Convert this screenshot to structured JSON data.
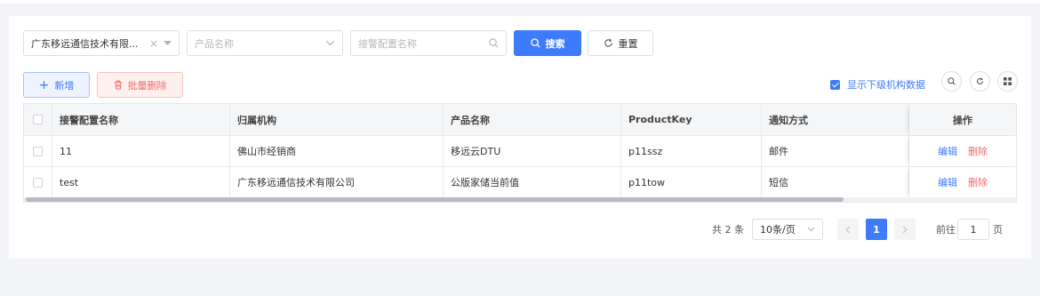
{
  "filters": {
    "org_value": "广东移远通信技术有限...",
    "product_placeholder": "产品名称",
    "alarm_placeholder": "接警配置名称"
  },
  "buttons": {
    "search": "搜索",
    "reset": "重置",
    "add": "新增",
    "batch_delete": "批量删除"
  },
  "toolbar": {
    "show_sub_org": "显示下级机构数据",
    "show_sub_org_checked": true
  },
  "table": {
    "headers": [
      "接警配置名称",
      "归属机构",
      "产品名称",
      "ProductKey",
      "通知方式",
      "操作"
    ],
    "rows": [
      {
        "name": "11",
        "org": "佛山市经销商",
        "product": "移远云DTU",
        "key": "p11ssz",
        "notify": "邮件"
      },
      {
        "name": "test",
        "org": "广东移远通信技术有限公司",
        "product": "公版家储当前值",
        "key": "p11tow",
        "notify": "短信"
      }
    ],
    "action_edit": "编辑",
    "action_delete": "删除"
  },
  "pagination": {
    "total_text": "共 2 条",
    "page_size": "10条/页",
    "current_page": "1",
    "goto_label": "前往",
    "goto_value": "1",
    "page_unit": "页"
  },
  "colors": {
    "primary": "#3e7bfa",
    "danger": "#f26b6b"
  },
  "icons": [
    "close-icon",
    "chevron-down-icon",
    "search-icon",
    "refresh-icon",
    "plus-icon",
    "trash-icon",
    "grid-icon",
    "chevron-left-icon",
    "chevron-right-icon"
  ]
}
